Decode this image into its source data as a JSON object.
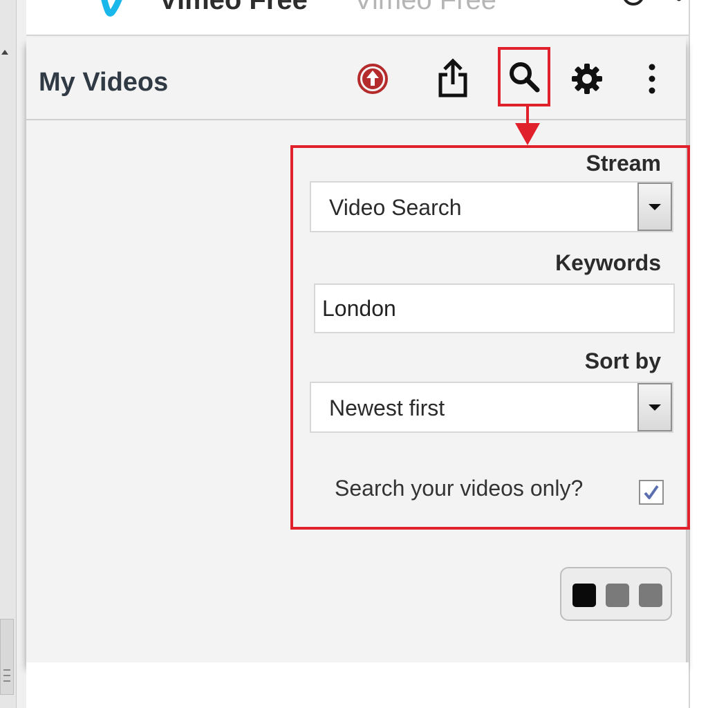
{
  "window": {
    "title": "Vimeo Free",
    "subtitle": "Vimeo Free"
  },
  "panel": {
    "title": "My Videos",
    "toolbar": {
      "upload_icon": "upload-circle-icon",
      "share_icon": "share-icon",
      "search_icon": "search-icon",
      "settings_icon": "gear-icon",
      "menu_icon": "more-vertical-icon"
    }
  },
  "search_form": {
    "stream_label": "Stream",
    "stream_value": "Video Search",
    "keywords_label": "Keywords",
    "keywords_value": "London",
    "sort_label": "Sort by",
    "sort_value": "Newest first",
    "own_only_label": "Search your videos only?",
    "own_only_checked": true
  },
  "view_toggle": {
    "dots": [
      "#0a0a0a",
      "#7a7a7a",
      "#7a7a7a"
    ]
  },
  "colors": {
    "highlight": "#e0202a",
    "upload_icon": "#b52a2a",
    "vimeo_blue": "#1ab7ea"
  }
}
